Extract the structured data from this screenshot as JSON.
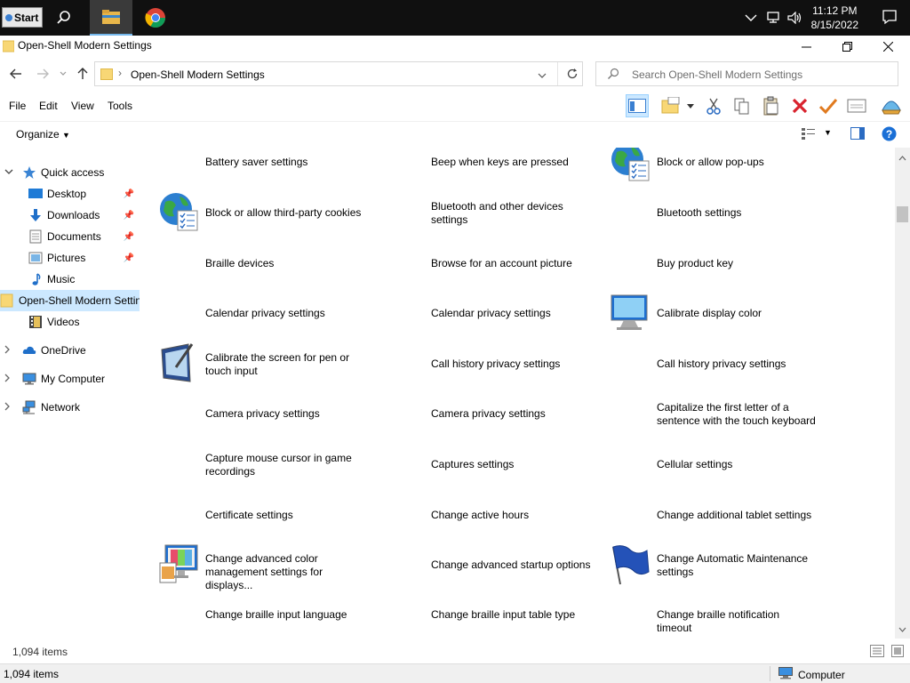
{
  "taskbar": {
    "start_label": "Start",
    "time": "11:12 PM",
    "date": "8/15/2022"
  },
  "window": {
    "title": "Open-Shell Modern Settings"
  },
  "address": {
    "path": "Open-Shell Modern Settings",
    "search_placeholder": "Search Open-Shell Modern Settings"
  },
  "menu": [
    "File",
    "Edit",
    "View",
    "Tools"
  ],
  "toolbar": {
    "organize_label": "Organize"
  },
  "nav": {
    "quick_access": "Quick access",
    "items": [
      {
        "label": "Desktop",
        "pinned": true
      },
      {
        "label": "Downloads",
        "pinned": true
      },
      {
        "label": "Documents",
        "pinned": true
      },
      {
        "label": "Pictures",
        "pinned": true
      },
      {
        "label": "Music",
        "pinned": false
      },
      {
        "label": "Open-Shell Modern Settings",
        "pinned": false
      },
      {
        "label": "Videos",
        "pinned": false
      }
    ],
    "onedrive": "OneDrive",
    "my_computer": "My Computer",
    "network": "Network"
  },
  "items": [
    {
      "label": "Battery saver settings",
      "icon": "none"
    },
    {
      "label": "Beep when keys are pressed",
      "icon": "none"
    },
    {
      "label": "Block or allow pop-ups",
      "icon": "globe-checklist"
    },
    {
      "label": "Block or allow third-party cookies",
      "icon": "globe-checklist"
    },
    {
      "label": "Bluetooth and other devices settings",
      "icon": "none"
    },
    {
      "label": "Bluetooth settings",
      "icon": "none"
    },
    {
      "label": "Braille devices",
      "icon": "none"
    },
    {
      "label": "Browse for an account picture",
      "icon": "none"
    },
    {
      "label": "Buy product key",
      "icon": "none"
    },
    {
      "label": "Calendar privacy settings",
      "icon": "none"
    },
    {
      "label": "Calendar privacy settings",
      "icon": "none"
    },
    {
      "label": "Calibrate display color",
      "icon": "monitor"
    },
    {
      "label": "Calibrate the screen for pen or touch input",
      "icon": "tablet-pen"
    },
    {
      "label": "Call history privacy settings",
      "icon": "none"
    },
    {
      "label": "Call history privacy settings",
      "icon": "none"
    },
    {
      "label": "Camera privacy settings",
      "icon": "none"
    },
    {
      "label": "Camera privacy settings",
      "icon": "none"
    },
    {
      "label": "Capitalize the first letter of a sentence with the touch keyboard",
      "icon": "none"
    },
    {
      "label": "Capture mouse cursor in game recordings",
      "icon": "none"
    },
    {
      "label": "Captures settings",
      "icon": "none"
    },
    {
      "label": "Cellular settings",
      "icon": "none"
    },
    {
      "label": "Certificate settings",
      "icon": "none"
    },
    {
      "label": "Change active hours",
      "icon": "none"
    },
    {
      "label": "Change additional tablet settings",
      "icon": "none"
    },
    {
      "label": "Change advanced color management settings for displays...",
      "icon": "color-monitor"
    },
    {
      "label": "Change advanced startup options",
      "icon": "none"
    },
    {
      "label": "Change Automatic Maintenance settings",
      "icon": "flag"
    },
    {
      "label": "Change braille input language",
      "icon": "none"
    },
    {
      "label": "Change braille input table type",
      "icon": "none"
    },
    {
      "label": "Change braille notification timeout",
      "icon": "none"
    }
  ],
  "status": {
    "item_count": "1,094 items",
    "item_count_bottom": "1,094 items",
    "zone": "Computer"
  },
  "colors": {
    "selection": "#cce8ff",
    "accent": "#0063b1",
    "taskbar": "#101010"
  }
}
